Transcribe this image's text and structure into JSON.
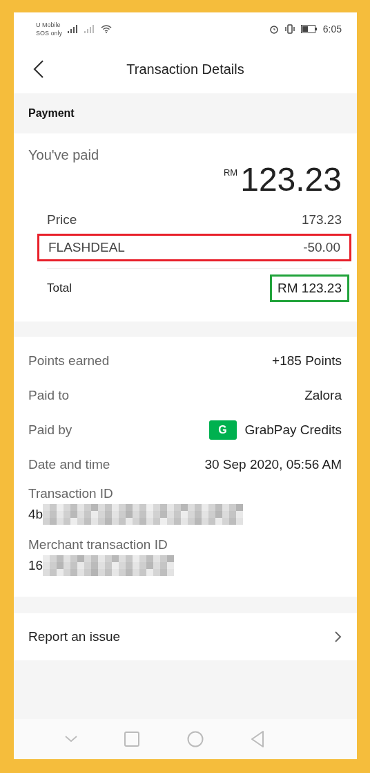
{
  "status_bar": {
    "carrier": "U Mobile",
    "carrier_status": "SOS only",
    "time": "6:05"
  },
  "header": {
    "title": "Transaction Details"
  },
  "payment": {
    "section_title": "Payment",
    "paid_label": "You've paid",
    "currency": "RM",
    "amount": "123.23",
    "breakdown": [
      {
        "label": "Price",
        "value": "173.23"
      },
      {
        "label": "FLASHDEAL",
        "value": "-50.00",
        "color": "#e8202a"
      }
    ],
    "total": {
      "label": "Total",
      "value": "RM 123.23",
      "color": "#21a33b"
    }
  },
  "details": [
    {
      "kind": "pair",
      "label": "Points earned",
      "value": "+185 Points"
    },
    {
      "kind": "pair",
      "label": "Paid to",
      "value": "Zalora"
    },
    {
      "kind": "method",
      "label": "Paid by",
      "badge": "G",
      "value": "GrabPay Credits"
    },
    {
      "kind": "pair",
      "label": "Date and time",
      "value": "30 Sep 2020, 05:56 AM"
    },
    {
      "kind": "redacted",
      "label": "Transaction ID",
      "value": "4b"
    },
    {
      "kind": "redacted",
      "label": "Merchant transaction ID",
      "value": "16"
    }
  ],
  "report": {
    "label": "Report an issue"
  }
}
